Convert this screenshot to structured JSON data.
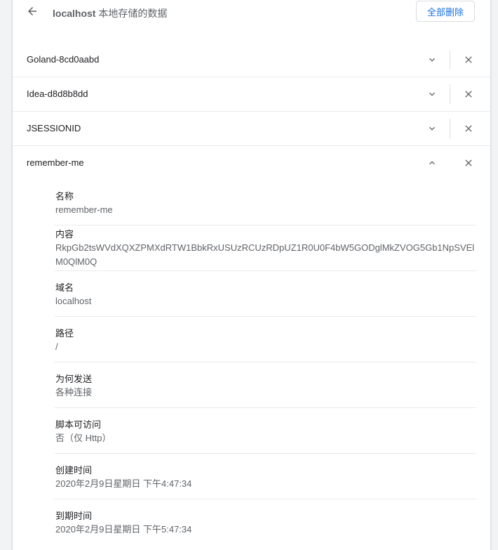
{
  "header": {
    "host": "localhost",
    "title_suffix": "本地存储的数据",
    "remove_all_label": "全部删除"
  },
  "cookies": [
    {
      "name": "Goland-8cd0aabd",
      "expanded": false
    },
    {
      "name": "Idea-d8d8b8dd",
      "expanded": false
    },
    {
      "name": "JSESSIONID",
      "expanded": false
    },
    {
      "name": "remember-me",
      "expanded": true
    }
  ],
  "details": {
    "name": {
      "label": "名称",
      "value": "remember-me"
    },
    "content": {
      "label": "内容",
      "value": "RkpGb2tsWVdXQXZPMXdRTW1BbkRxUSUzRCUzRDpUZ1R0U0F4bW5GODglMkZVOG5Gb1NpSVElM0QlM0Q"
    },
    "domain": {
      "label": "域名",
      "value": "localhost"
    },
    "path": {
      "label": "路径",
      "value": "/"
    },
    "send_for": {
      "label": "为何发送",
      "value": "各种连接"
    },
    "accessible_to_script": {
      "label": "脚本可访问",
      "value": "否（仅 Http）"
    },
    "created": {
      "label": "创建时间",
      "value": "2020年2月9日星期日 下午4:47:34"
    },
    "expires": {
      "label": "到期时间",
      "value": "2020年2月9日星期日 下午5:47:34"
    }
  },
  "icons": {
    "back": "arrow-back-icon",
    "expand": "chevron-down-icon",
    "collapse": "chevron-up-icon",
    "remove": "close-icon"
  },
  "colors": {
    "accent": "#1a73e8",
    "text_primary": "#202124",
    "text_secondary": "#5f6368",
    "divider": "#e8eaed"
  }
}
